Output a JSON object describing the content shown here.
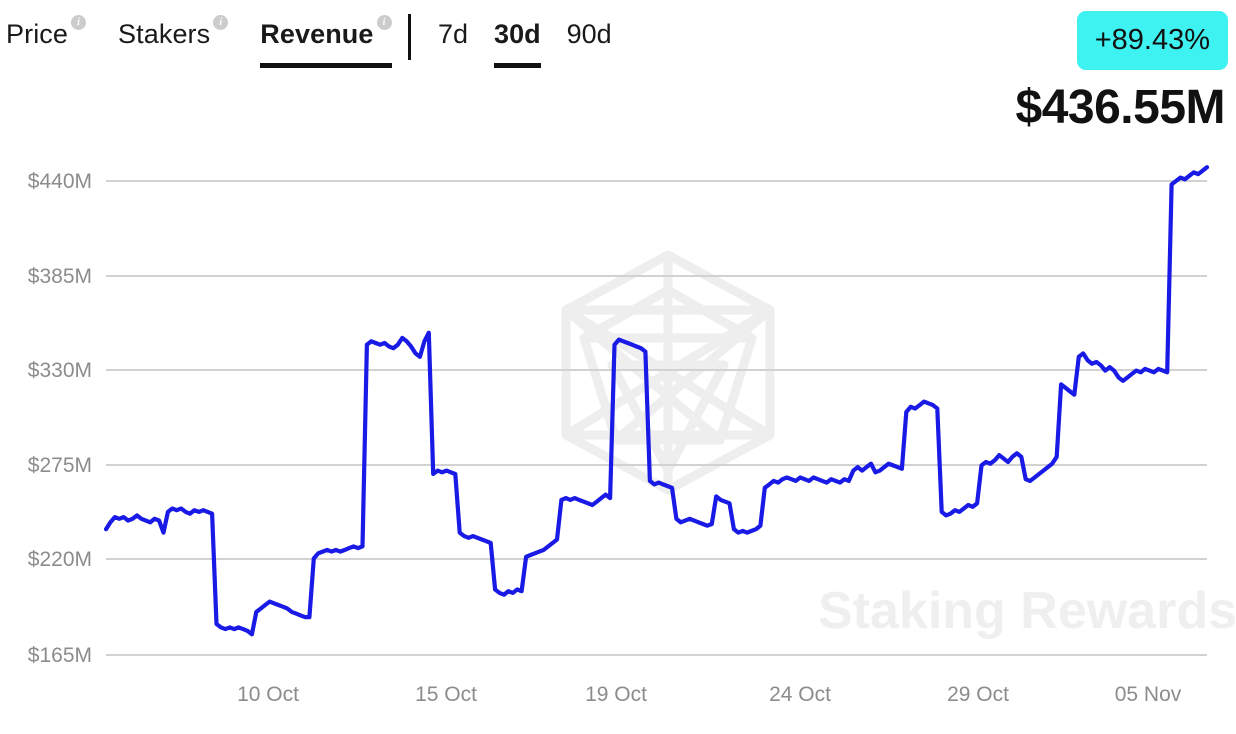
{
  "header": {
    "metric_tabs": [
      {
        "label": "Price",
        "active": false,
        "info_icon": "info-icon"
      },
      {
        "label": "Stakers",
        "active": false,
        "info_icon": "info-icon"
      },
      {
        "label": "Revenue",
        "active": true,
        "info_icon": "info-icon"
      }
    ],
    "range_tabs": [
      {
        "label": "7d",
        "active": false
      },
      {
        "label": "30d",
        "active": true
      },
      {
        "label": "90d",
        "active": false
      }
    ],
    "change_badge": {
      "text": "+89.43%",
      "background_color": "#3FF2F2",
      "text_color": "#111111"
    },
    "headline_value": "$436.55M"
  },
  "colors": {
    "line": "#1A1AE6",
    "gridline": "#d2d2d2",
    "tick_label": "#8c8c8c",
    "accent": "#3FF2F2",
    "watermark": "#efefef",
    "background": "#ffffff"
  },
  "watermark": {
    "text": "Staking Rewards",
    "logo_name": "staking-rewards-polyhedron-logo"
  },
  "chart_data": {
    "type": "line",
    "title": "Revenue",
    "xlabel": "",
    "ylabel": "",
    "unit": "USD",
    "grid": true,
    "legend": false,
    "ylim": [
      165,
      467
    ],
    "y_ticks": [
      440,
      385,
      330,
      275,
      220,
      165
    ],
    "y_tick_labels": [
      "$440M",
      "$385M",
      "$330M",
      "$275M",
      "$220M",
      "$165M"
    ],
    "x_tick_labels": [
      "10 Oct",
      "15 Oct",
      "19 Oct",
      "24 Oct",
      "29 Oct",
      "05 Nov"
    ],
    "x_tick_positions": [
      0.147,
      0.309,
      0.463,
      0.625,
      0.787,
      0.949
    ],
    "series": [
      {
        "name": "Revenue",
        "color": "#1A1AE6",
        "values": [
          238,
          242,
          245,
          244,
          245,
          243,
          244,
          246,
          244,
          243,
          242,
          244,
          243,
          236,
          248,
          250,
          249,
          250,
          248,
          247,
          249,
          248,
          249,
          248,
          247,
          183,
          181,
          180,
          181,
          180,
          181,
          180,
          179,
          177,
          190,
          192,
          194,
          196,
          195,
          194,
          193,
          192,
          190,
          189,
          188,
          187,
          187,
          221,
          224,
          225,
          226,
          225,
          226,
          225,
          226,
          227,
          228,
          227,
          228,
          345,
          347,
          346,
          345,
          346,
          344,
          343,
          345,
          349,
          347,
          344,
          340,
          338,
          347,
          352,
          270,
          272,
          271,
          272,
          271,
          270,
          236,
          234,
          233,
          234,
          233,
          232,
          231,
          230,
          203,
          201,
          200,
          202,
          201,
          203,
          202,
          222,
          223,
          224,
          225,
          226,
          228,
          230,
          232,
          255,
          256,
          255,
          256,
          255,
          254,
          253,
          252,
          254,
          256,
          258,
          256,
          345,
          348,
          347,
          346,
          345,
          344,
          343,
          341,
          266,
          264,
          265,
          264,
          263,
          262,
          244,
          242,
          243,
          244,
          243,
          242,
          241,
          240,
          241,
          257,
          255,
          254,
          253,
          238,
          236,
          237,
          236,
          237,
          238,
          240,
          262,
          264,
          266,
          265,
          267,
          268,
          267,
          266,
          268,
          267,
          266,
          268,
          267,
          266,
          265,
          267,
          266,
          265,
          267,
          266,
          272,
          274,
          272,
          274,
          276,
          271,
          272,
          274,
          276,
          275,
          274,
          273,
          306,
          309,
          308,
          310,
          312,
          311,
          310,
          308,
          248,
          246,
          247,
          249,
          248,
          250,
          252,
          251,
          253,
          275,
          277,
          276,
          278,
          281,
          279,
          277,
          280,
          282,
          280,
          267,
          266,
          268,
          270,
          272,
          274,
          276,
          280,
          322,
          320,
          318,
          316,
          338,
          340,
          336,
          334,
          335,
          333,
          330,
          332,
          330,
          326,
          324,
          326,
          328,
          330,
          329,
          331,
          330,
          329,
          331,
          330,
          329,
          438,
          440,
          442,
          441,
          443,
          445,
          444,
          446,
          448
        ]
      }
    ],
    "latest_value": 436.55,
    "change_percent": 89.43
  }
}
